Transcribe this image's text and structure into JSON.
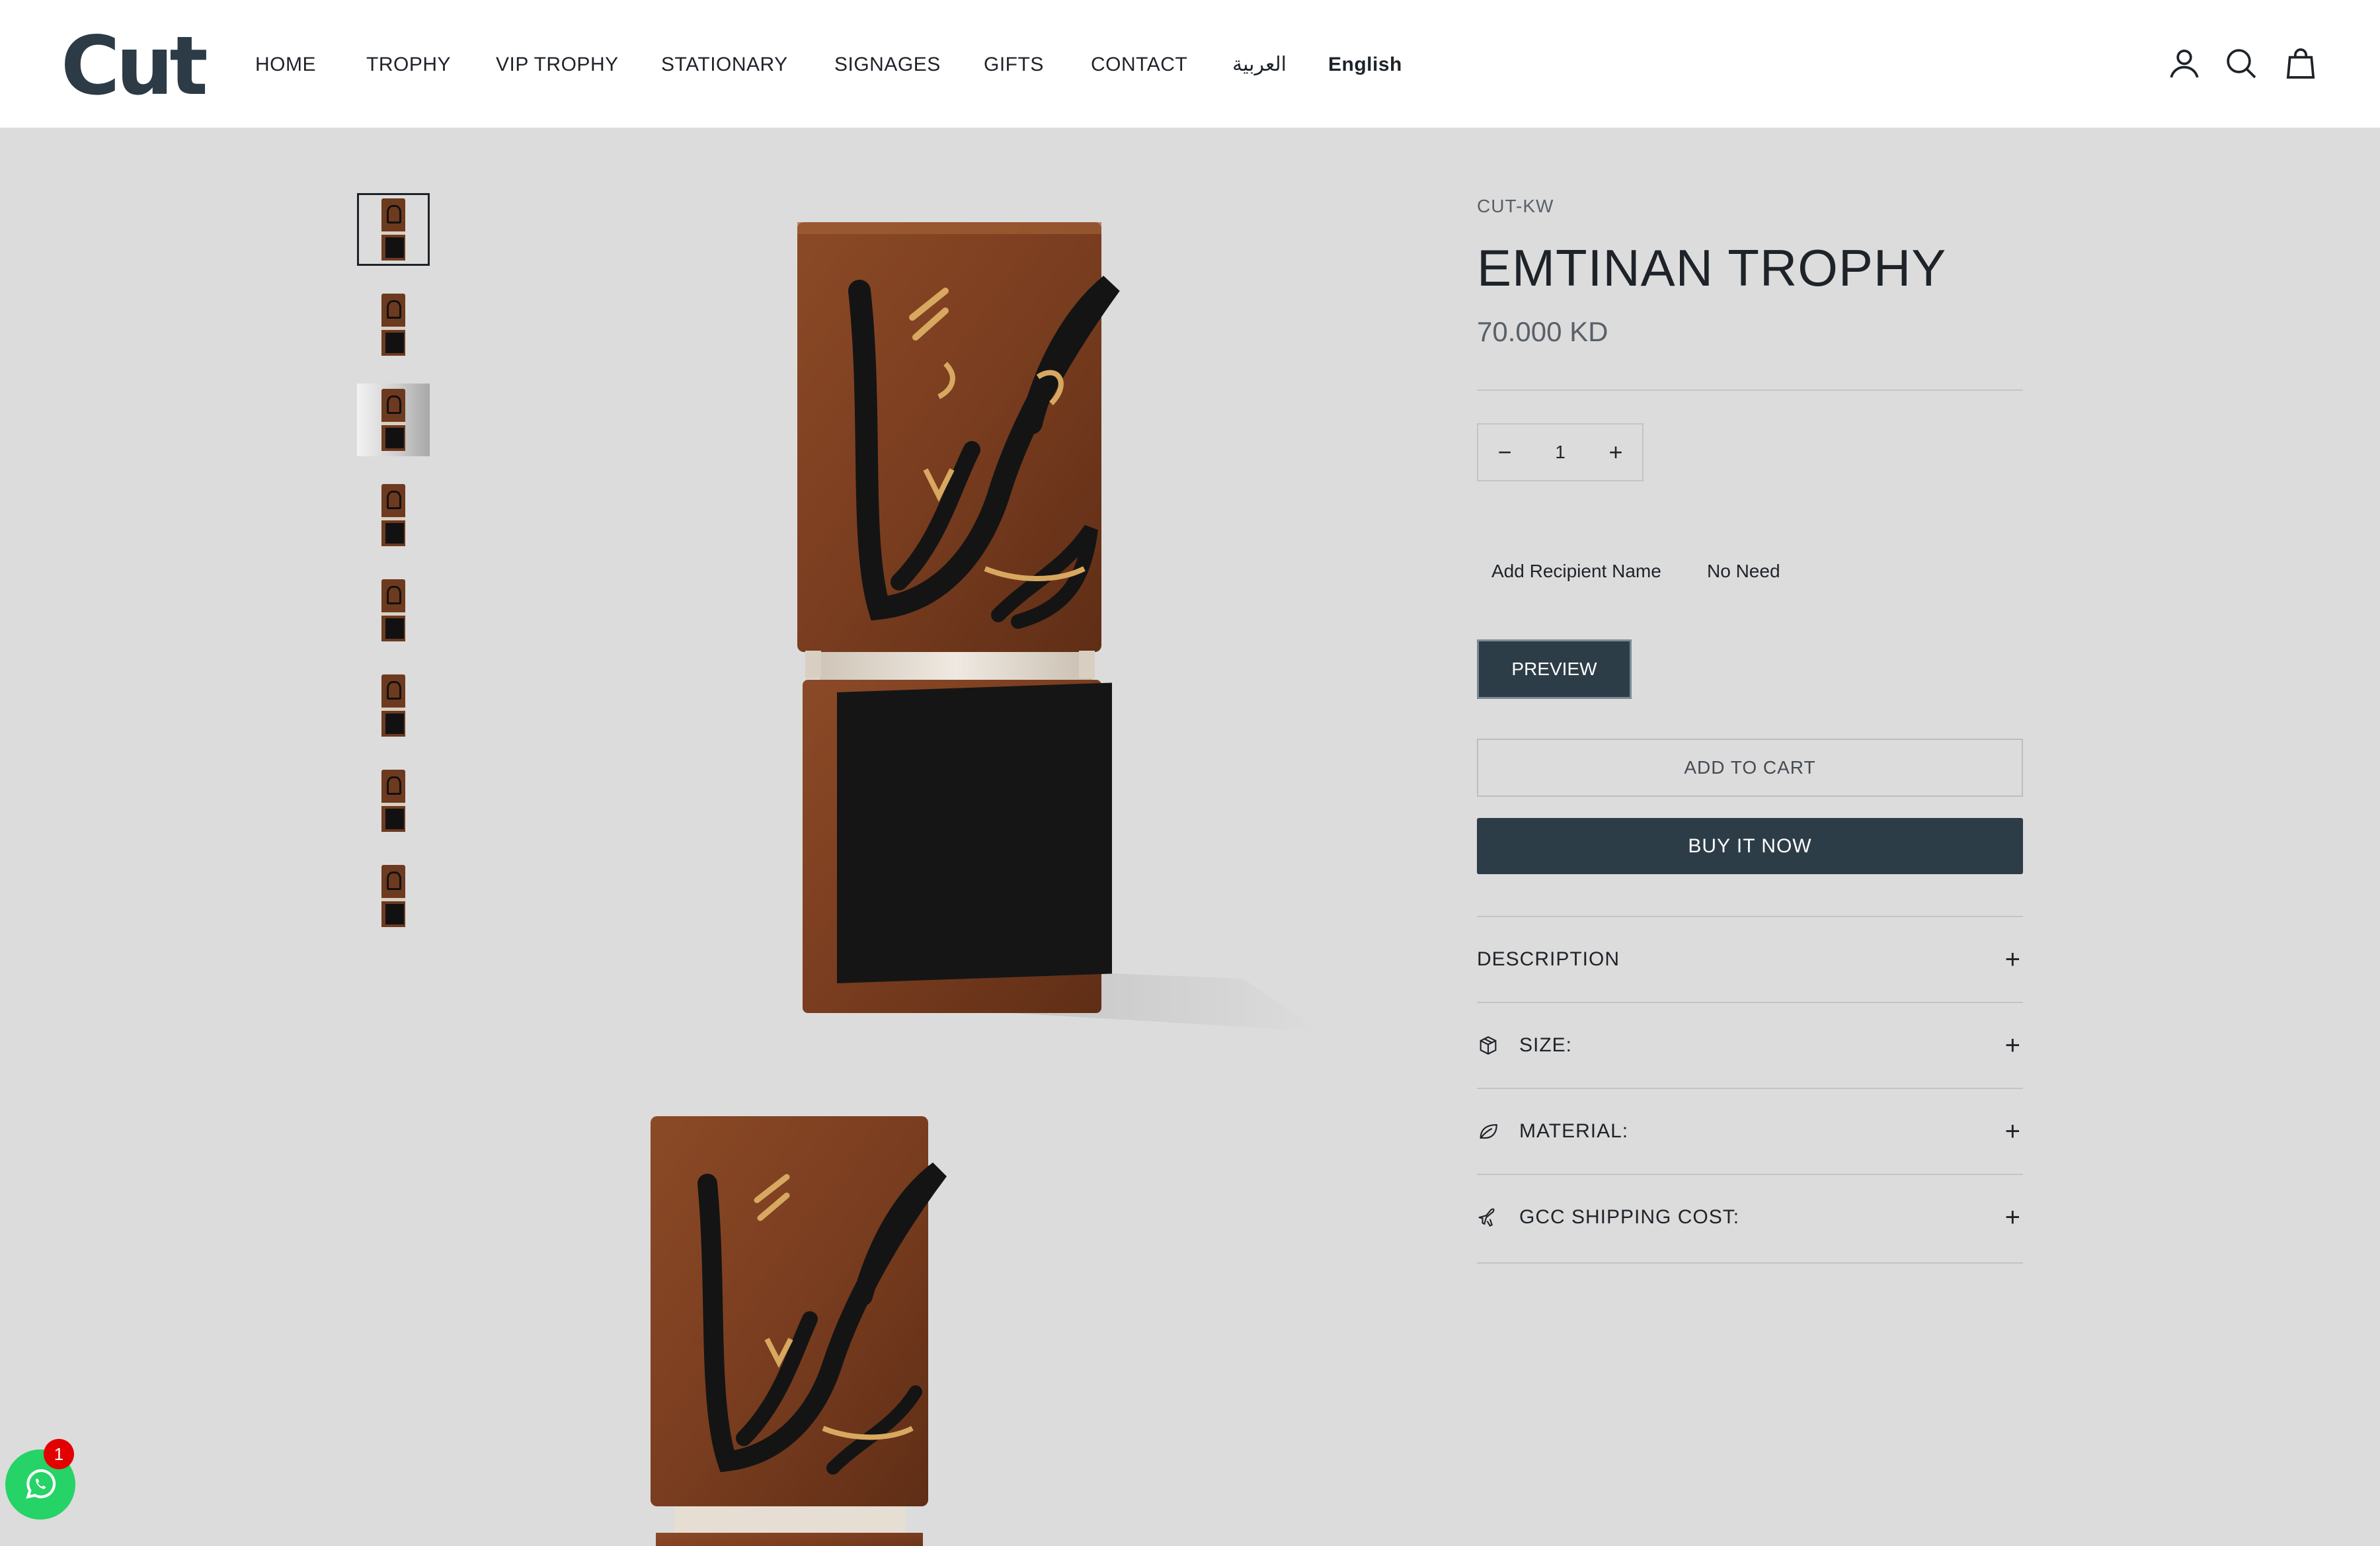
{
  "header": {
    "logo": "Cut",
    "nav": [
      {
        "label": "HOME"
      },
      {
        "label": "TROPHY"
      },
      {
        "label": "VIP TROPHY"
      },
      {
        "label": "STATIONARY"
      },
      {
        "label": "SIGNAGES"
      },
      {
        "label": "GIFTS"
      },
      {
        "label": "CONTACT"
      },
      {
        "label": "العربية"
      },
      {
        "label": "English"
      }
    ],
    "icons": [
      "account-icon",
      "search-icon",
      "bag-icon"
    ]
  },
  "gallery": {
    "thumbnail_count": 8,
    "active_index": 0
  },
  "product": {
    "vendor": "CUT-KW",
    "title": "EMTINAN TROPHY",
    "price": "70.000 KD",
    "quantity": {
      "minus": "−",
      "value": "1",
      "plus": "+"
    },
    "recipient_label": "Add Recipient Name",
    "recipient_value": "No Need",
    "preview_label": "PREVIEW",
    "add_to_cart_label": "ADD TO CART",
    "buy_now_label": "BUY IT NOW",
    "accordions": [
      {
        "label": "DESCRIPTION",
        "icon": ""
      },
      {
        "label": "SIZE:",
        "icon": "box-icon"
      },
      {
        "label": "MATERIAL:",
        "icon": "leaf-icon"
      },
      {
        "label": "GCC SHIPPING COST:",
        "icon": "plane-icon"
      }
    ],
    "accordion_toggle": "+"
  },
  "whatsapp": {
    "badge_count": "1",
    "colors": {
      "button": "#25d366",
      "badge": "#e30000"
    }
  },
  "colors": {
    "page_bg": "#dcdcdc",
    "header_bg": "#ffffff",
    "primary_button": "#2d3d48",
    "logo": "#2c3b45"
  }
}
